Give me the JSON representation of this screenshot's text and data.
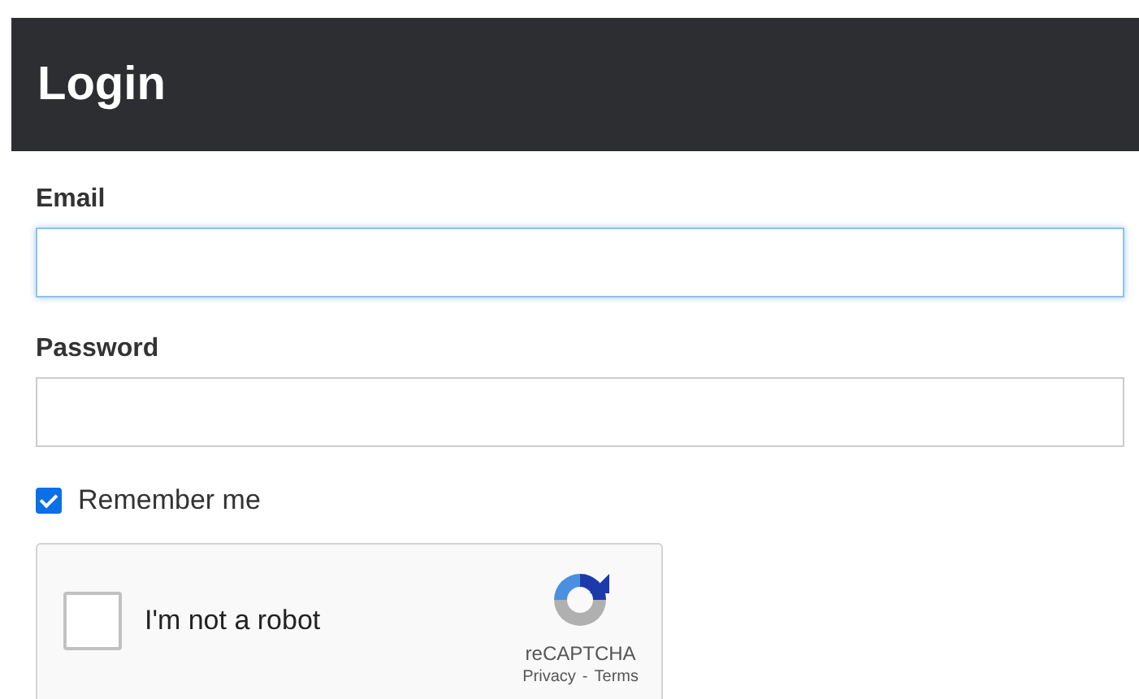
{
  "header": {
    "title": "Login"
  },
  "fields": [
    {
      "label": "Email",
      "focused": true
    },
    {
      "label": "Password",
      "focused": false
    }
  ],
  "remember": {
    "label": "Remember me",
    "checked": true
  },
  "captcha": {
    "label": "I'm not a robot",
    "checked": false,
    "brand": "reCAPTCHA",
    "links": [
      "Privacy",
      "Terms"
    ],
    "separator": "-"
  }
}
